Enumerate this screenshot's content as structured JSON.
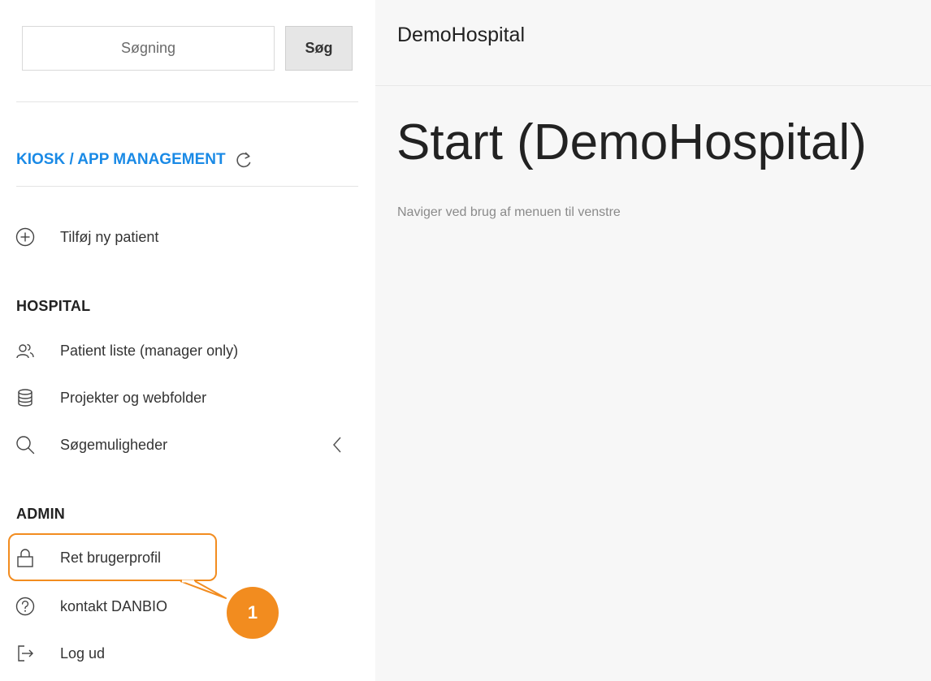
{
  "search": {
    "placeholder": "Søgning",
    "button_label": "Søg"
  },
  "kiosk": {
    "label": "KIOSK / APP MANAGEMENT"
  },
  "menu": {
    "add_patient": "Tilføj ny patient",
    "hospital_title": "HOSPITAL",
    "patient_list": "Patient liste (manager only)",
    "projects": "Projekter og webfolder",
    "search_options": "Søgemuligheder",
    "admin_title": "ADMIN",
    "edit_profile": "Ret brugerprofil",
    "contact": "kontakt DANBIO",
    "logout": "Log ud"
  },
  "annotation": {
    "badge": "1",
    "color": "#f28c1f"
  },
  "header": {
    "brand": "DemoHospital"
  },
  "main": {
    "title": "Start (DemoHospital)",
    "subtitle": "Naviger ved brug af menuen til venstre"
  },
  "colors": {
    "accent": "#1a8ae6",
    "highlight": "#f28c1f",
    "main_bg": "#f7f7f7"
  },
  "icons": {
    "refresh": "refresh-icon",
    "add": "plus-circle-icon",
    "users": "users-icon",
    "database": "database-icon",
    "search": "search-icon",
    "chevron": "chevron-left-icon",
    "lock": "lock-icon",
    "help": "help-circle-icon",
    "logout": "logout-icon"
  }
}
